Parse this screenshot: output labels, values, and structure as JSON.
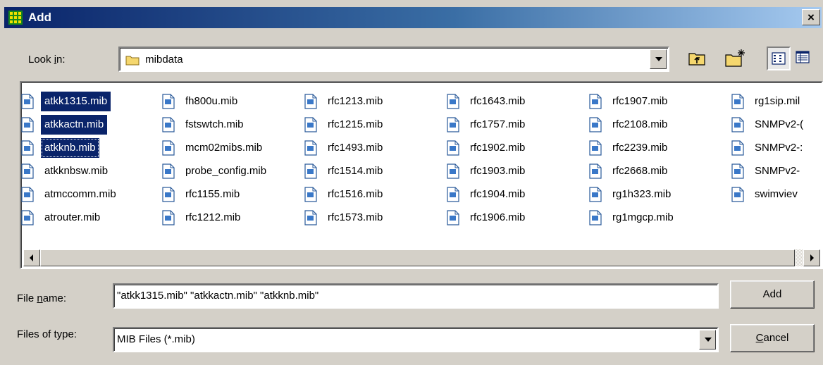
{
  "window": {
    "title": "Add",
    "close_label": "×"
  },
  "look_in": {
    "label_pre": "Look ",
    "label_u": "i",
    "label_post": "n:",
    "value": "mibdata"
  },
  "toolbar": {
    "icons": [
      "up-folder-icon",
      "new-folder-icon",
      "list-view-icon",
      "details-view-icon"
    ]
  },
  "files": [
    [
      "atkk1315.mib",
      "atkkactn.mib",
      "atkknb.mib",
      "atkknbsw.mib",
      "atmccomm.mib",
      "atrouter.mib"
    ],
    [
      "fh800u.mib",
      "fstswtch.mib",
      "mcm02mibs.mib",
      "probe_config.mib",
      "rfc1155.mib",
      "rfc1212.mib"
    ],
    [
      "rfc1213.mib",
      "rfc1215.mib",
      "rfc1493.mib",
      "rfc1514.mib",
      "rfc1516.mib",
      "rfc1573.mib"
    ],
    [
      "rfc1643.mib",
      "rfc1757.mib",
      "rfc1902.mib",
      "rfc1903.mib",
      "rfc1904.mib",
      "rfc1906.mib"
    ],
    [
      "rfc1907.mib",
      "rfc2108.mib",
      "rfc2239.mib",
      "rfc2668.mib",
      "rg1h323.mib",
      "rg1mgcp.mib"
    ],
    [
      "rg1sip.mil",
      "SNMPv2-(",
      "SNMPv2-:",
      "SNMPv2-",
      "swimviev"
    ]
  ],
  "selected_files": [
    "atkk1315.mib",
    "atkkactn.mib",
    "atkknb.mib"
  ],
  "file_name": {
    "label_pre": "File ",
    "label_u": "n",
    "label_post": "ame:",
    "value": "\"atkk1315.mib\" \"atkkactn.mib\" \"atkknb.mib\""
  },
  "file_type": {
    "label": "Files of type:",
    "value": "MIB Files (*.mib)"
  },
  "buttons": {
    "add": "Add",
    "cancel_u": "C",
    "cancel_rest": "ancel"
  },
  "colors": {
    "selection": "#0a246a",
    "face": "#d4d0c8",
    "title_start": "#0a246a"
  }
}
